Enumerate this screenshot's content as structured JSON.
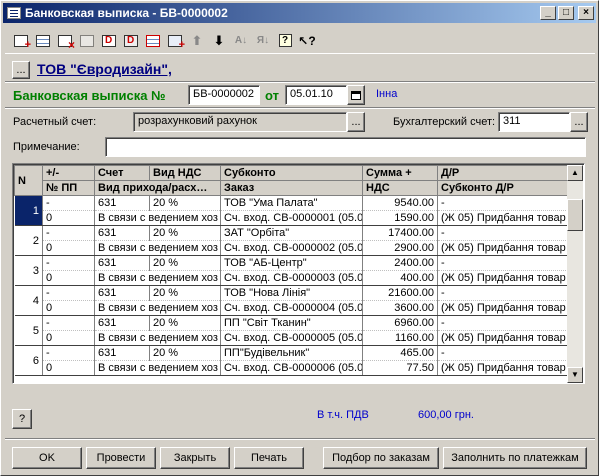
{
  "window": {
    "title": "Банковская выписка - БВ-0000002",
    "controls": [
      "_",
      "□",
      "×"
    ]
  },
  "toolbar": {
    "icons": [
      "new-row-icon",
      "new-group-icon",
      "delete-row-icon",
      "copy-row-icon",
      "mark-delete-icon",
      "clear-delete-icon",
      "insert-row-icon",
      "insert-column-icon",
      "move-up-icon",
      "move-down-icon",
      "sort-asc-icon",
      "sort-desc-icon",
      "help-icon",
      "context-help-icon"
    ]
  },
  "header": {
    "company_button": "...",
    "company": "ТОВ \"Євродизайн\",",
    "doc_label": "Банковская выписка №",
    "doc_number": "БВ-0000002",
    "from_label": "от",
    "doc_date": "05.01.10",
    "author": "Інна"
  },
  "fields": {
    "account_label": "Расчетный счет:",
    "account_value": "розрахунковий рахунок",
    "ledger_label": "Бухгалтерский счет:",
    "ledger_value": "311",
    "note_label": "Примечание:",
    "note_value": "",
    "pick_label": "..."
  },
  "table": {
    "headers_row1": [
      "N",
      "+/-",
      "Счет",
      "Вид НДС",
      "Субконто",
      "Сумма +",
      "Д/Р"
    ],
    "headers_row2": [
      "",
      "№ ПП",
      "Вид прихода/расх…",
      "",
      "Заказ",
      "НДС",
      "Субконто Д/Р"
    ],
    "rows": [
      {
        "n": "1",
        "sign": "-",
        "account": "631",
        "vat": "20 %",
        "sub": "ТОВ \"Ума Палата\"",
        "sum": "9540.00",
        "dr": "-",
        "pp": "0",
        "kind": "В связи с ведением хоз",
        "order": "Сч. вход. СВ-0000001 (05.0",
        "nds": "1590.00",
        "dr_sub": "(Ж 05) Придбання товар"
      },
      {
        "n": "2",
        "sign": "-",
        "account": "631",
        "vat": "20 %",
        "sub": "ЗАТ \"Орбіта\"",
        "sum": "17400.00",
        "dr": "-",
        "pp": "0",
        "kind": "В связи с ведением хоз",
        "order": "Сч. вход. СВ-0000002 (05.0",
        "nds": "2900.00",
        "dr_sub": "(Ж 05) Придбання товар"
      },
      {
        "n": "3",
        "sign": "-",
        "account": "631",
        "vat": "20 %",
        "sub": "ТОВ \"АБ-Центр\"",
        "sum": "2400.00",
        "dr": "-",
        "pp": "0",
        "kind": "В связи с ведением хоз",
        "order": "Сч. вход. СВ-0000003 (05.0",
        "nds": "400.00",
        "dr_sub": "(Ж 05) Придбання товар"
      },
      {
        "n": "4",
        "sign": "-",
        "account": "631",
        "vat": "20 %",
        "sub": "ТОВ \"Нова Лінія\"",
        "sum": "21600.00",
        "dr": "-",
        "pp": "0",
        "kind": "В связи с ведением хоз",
        "order": "Сч. вход. СВ-0000004 (05.0",
        "nds": "3600.00",
        "dr_sub": "(Ж 05) Придбання товар"
      },
      {
        "n": "5",
        "sign": "-",
        "account": "631",
        "vat": "20 %",
        "sub": "ПП \"Світ Тканин\"",
        "sum": "6960.00",
        "dr": "-",
        "pp": "0",
        "kind": "В связи с ведением хоз",
        "order": "Сч. вход. СВ-0000005 (05.0",
        "nds": "1160.00",
        "dr_sub": "(Ж 05) Придбання товар"
      },
      {
        "n": "6",
        "sign": "-",
        "account": "631",
        "vat": "20 %",
        "sub": "ПП\"Будівельник\"",
        "sum": "465.00",
        "dr": "-",
        "pp": "0",
        "kind": "В связи с ведением хоз",
        "order": "Сч. вход. СВ-0000006 (05.0",
        "nds": "77.50",
        "dr_sub": "(Ж 05) Придбання товар"
      }
    ]
  },
  "footer": {
    "help": "?",
    "vat_label": "В т.ч. ПДВ",
    "vat_value": "600,00 грн.",
    "buttons": {
      "ok": "OK",
      "post": "Провести",
      "close": "Закрыть",
      "print": "Печать",
      "pick_orders": "Подбор по заказам",
      "fill_payments": "Заполнить по платежкам"
    }
  }
}
